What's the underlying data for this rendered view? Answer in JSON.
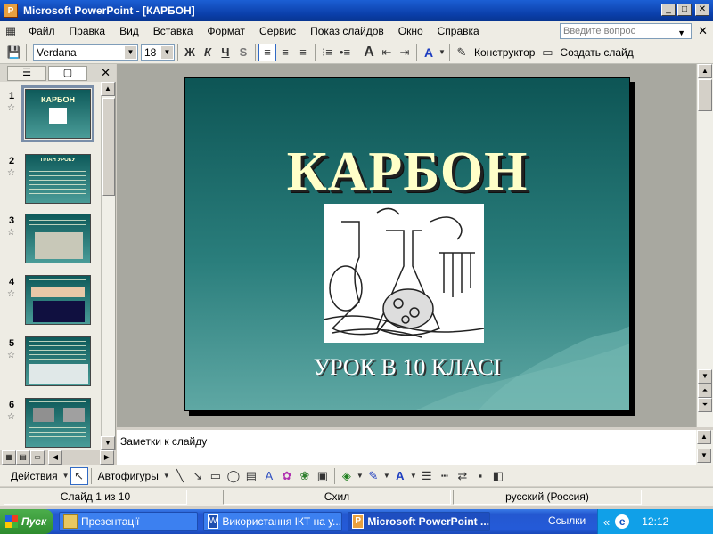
{
  "window": {
    "title": "Microsoft PowerPoint - [КАРБОН]"
  },
  "menu": {
    "items": [
      "Файл",
      "Правка",
      "Вид",
      "Вставка",
      "Формат",
      "Сервис",
      "Показ слайдов",
      "Окно",
      "Справка"
    ],
    "help_placeholder": "Введите вопрос"
  },
  "toolbar": {
    "font": "Verdana",
    "size": "18",
    "bold": "Ж",
    "italic": "К",
    "underline": "Ч",
    "shadow": "S",
    "designer": "Конструктор",
    "new_slide": "Создать слайд"
  },
  "panel": {
    "tab_outline": "☰",
    "tab_slides": "▢",
    "close": "✕",
    "thumbnails": [
      {
        "num": "1",
        "title": "КАРБОН"
      },
      {
        "num": "2",
        "title": "ПЛАН УРОКУ"
      },
      {
        "num": "3",
        "title": ""
      },
      {
        "num": "4",
        "title": ""
      },
      {
        "num": "5",
        "title": ""
      },
      {
        "num": "6",
        "title": ""
      }
    ]
  },
  "slide": {
    "title": "КАРБОН",
    "subtitle": "УРОК В 10 КЛАСІ"
  },
  "notes": {
    "placeholder": "Заметки к слайду"
  },
  "drawing": {
    "actions": "Действия",
    "autoshapes": "Автофигуры"
  },
  "status": {
    "slide": "Слайд 1 из 10",
    "design": "Схил",
    "language": "русский (Россия)"
  },
  "taskbar": {
    "start": "Пуск",
    "tasks": [
      "Презентації",
      "Використання ІКТ на у...",
      "Microsoft PowerPoint ..."
    ],
    "links": "Ссылки",
    "time": "12:12"
  },
  "colors": {
    "accent": "#0a3ea8",
    "slide_top": "#0d5555",
    "slide_bottom": "#5fa8a4",
    "title_text": "#ffffc8"
  }
}
